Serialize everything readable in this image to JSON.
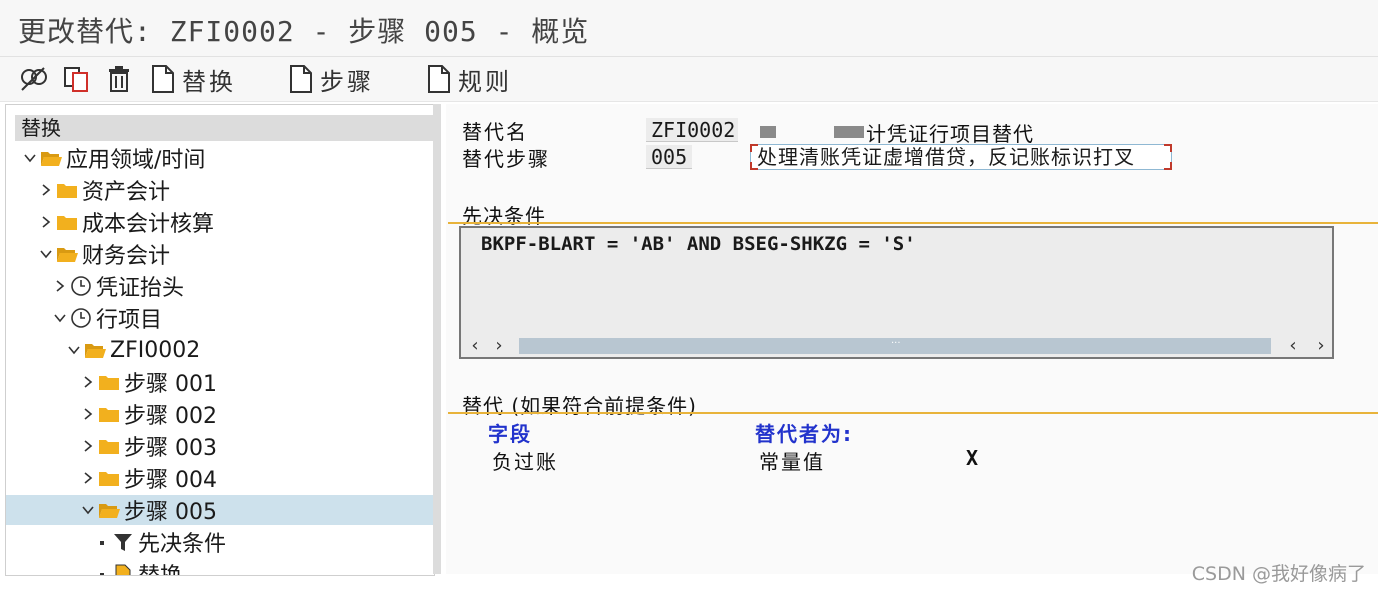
{
  "window": {
    "title": "更改替代: ZFI0002 - 步骤 005 - 概览"
  },
  "toolbar": {
    "buttons": [
      {
        "name": "display-change-icon"
      },
      {
        "name": "copy-icon"
      },
      {
        "name": "delete-icon"
      },
      {
        "name": "document-icon",
        "label": "替换"
      },
      {
        "name": "document-icon",
        "label": "步骤"
      },
      {
        "name": "document-icon",
        "label": "规则"
      }
    ]
  },
  "tree": {
    "header": "替换",
    "nodes": [
      {
        "label": "应用领域/时间",
        "expanded": true,
        "icon": "folder-open"
      },
      {
        "label": "资产会计",
        "expanded": false,
        "icon": "folder"
      },
      {
        "label": "成本会计核算",
        "expanded": false,
        "icon": "folder"
      },
      {
        "label": "财务会计",
        "expanded": true,
        "icon": "folder-open"
      },
      {
        "label": "凭证抬头",
        "expanded": false,
        "icon": "clock"
      },
      {
        "label": "行项目",
        "expanded": true,
        "icon": "clock"
      },
      {
        "label": "ZFI0002",
        "expanded": true,
        "icon": "folder-open"
      },
      {
        "label": "步骤 001",
        "expanded": false,
        "icon": "folder"
      },
      {
        "label": "步骤 002",
        "expanded": false,
        "icon": "folder"
      },
      {
        "label": "步骤 003",
        "expanded": false,
        "icon": "folder"
      },
      {
        "label": "步骤 004",
        "expanded": false,
        "icon": "folder"
      },
      {
        "label": "步骤 005",
        "expanded": true,
        "icon": "folder-open",
        "selected": true
      },
      {
        "label": "先决条件",
        "icon": "funnel"
      },
      {
        "label": "替换",
        "icon": "document"
      }
    ]
  },
  "substitution": {
    "name_label": "替代名",
    "name_value": "ZFI0002",
    "name_desc": "计凭证行项目替代",
    "step_label": "替代步骤",
    "step_value": "005",
    "step_desc": "处理清账凭证虚增借贷，反记账标识打叉"
  },
  "prerequisite": {
    "title": "先决条件",
    "condition": "BKPF-BLART = 'AB' AND BSEG-SHKZG = 'S'"
  },
  "replacement": {
    "title": "替代 (如果符合前提条件)",
    "col_field": "字段",
    "col_replaced_by": "替代者为:",
    "rows": [
      {
        "field": "负过账",
        "type": "常量值",
        "value": "X"
      }
    ]
  },
  "watermark": "CSDN @我好像病了",
  "colors": {
    "folder": "#f2b01e",
    "selected_row": "#cde1ec",
    "section_line": "#e8b33a",
    "column_header": "#2233cc"
  }
}
